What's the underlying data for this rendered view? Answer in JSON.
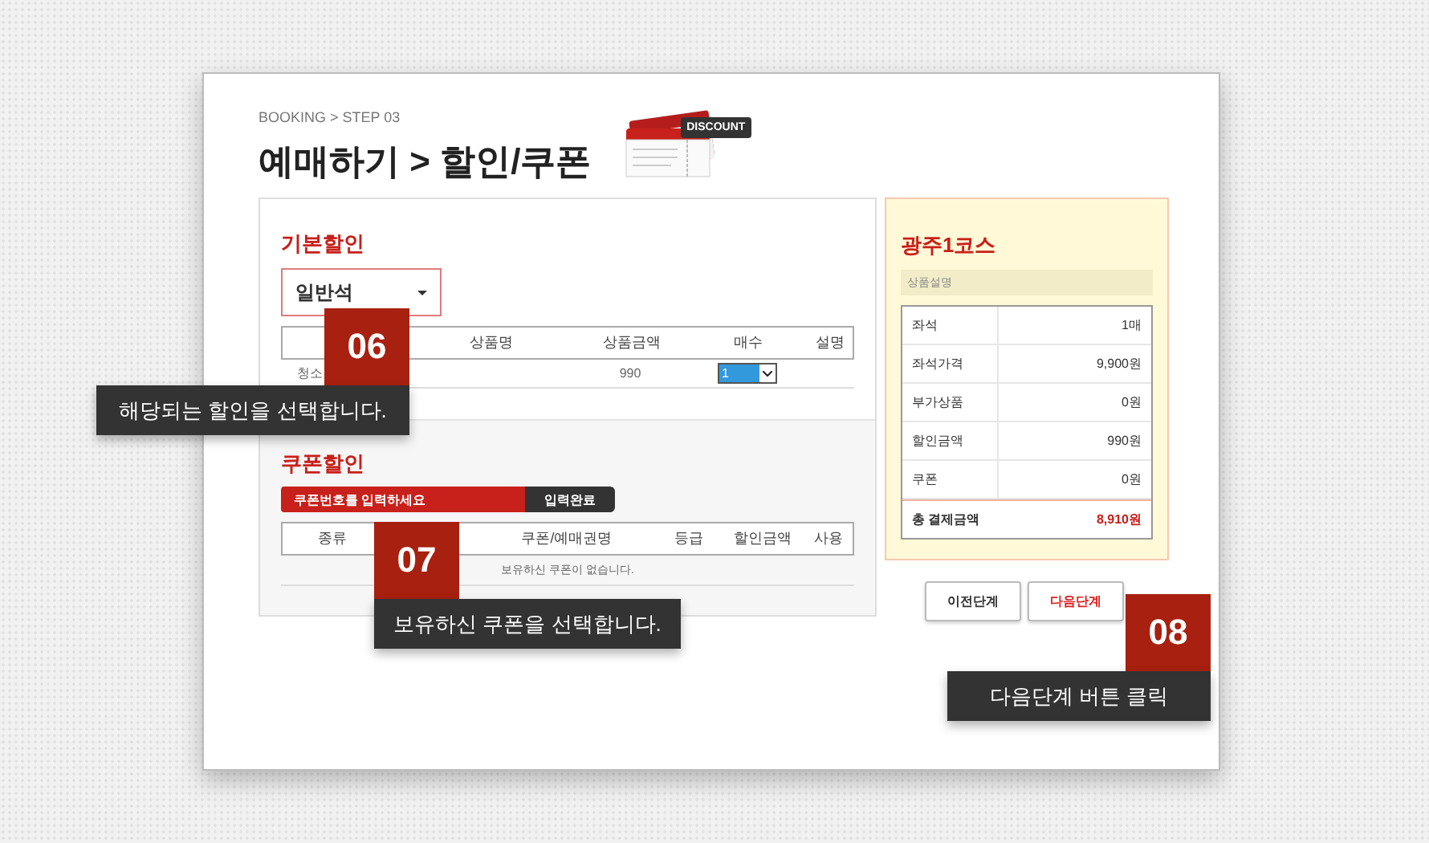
{
  "header": {
    "breadcrumb": "BOOKING > STEP 03",
    "title": "예매하기 > 할인/쿠폰",
    "tag": "DISCOUNT"
  },
  "basic_discount": {
    "heading": "기본할인",
    "select": "일반석",
    "columns": [
      "",
      "상품명",
      "상품금액",
      "매수",
      "설명"
    ],
    "rows": [
      {
        "name": "청소",
        "price": "990",
        "quantity": "1"
      }
    ]
  },
  "coupon": {
    "heading": "쿠폰할인",
    "placeholder": "쿠폰번호를 입력하세요",
    "apply": "입력완료",
    "columns": [
      "종류",
      "",
      "쿠폰/예매권명",
      "등급",
      "할인금액",
      "사용"
    ],
    "empty": "보유하신 쿠폰이 없습니다."
  },
  "summary": {
    "title": "광주1코스",
    "subtitle": "상품설명",
    "rows": [
      {
        "label": "좌석",
        "value": "1매",
        "kind": "normal"
      },
      {
        "label": "좌석가격",
        "value": "9,900원",
        "kind": "normal"
      },
      {
        "label": "부가상품",
        "value": "0원",
        "kind": "normal"
      },
      {
        "label": "할인금액",
        "value": "990원",
        "kind": "normal"
      },
      {
        "label": "쿠폰",
        "value": "0원",
        "kind": "normal"
      },
      {
        "label": "총 결제금액",
        "value": "8,910원",
        "kind": "total"
      }
    ]
  },
  "buttons": [
    {
      "label": "이전단계",
      "kind": "secondary"
    },
    {
      "label": "다음단계",
      "kind": "primary"
    }
  ],
  "callouts": [
    {
      "number": "06",
      "text": "해당되는 할인을 선택합니다."
    },
    {
      "number": "07",
      "text": "보유하신 쿠폰을 선택합니다."
    },
    {
      "number": "08",
      "text": "다음단계 버튼 클릭"
    }
  ]
}
